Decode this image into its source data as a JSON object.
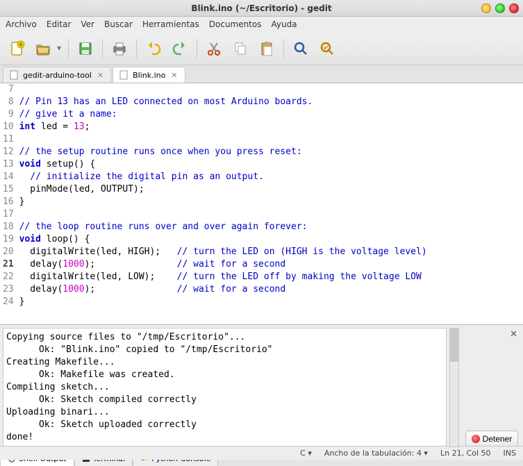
{
  "window": {
    "title": "Blink.ino (~/Escritorio) - gedit"
  },
  "menu": [
    "Archivo",
    "Editar",
    "Ver",
    "Buscar",
    "Herramientas",
    "Documentos",
    "Ayuda"
  ],
  "tabs": [
    {
      "label": "gedit-arduino-tool",
      "active": false
    },
    {
      "label": "Blink.ino",
      "active": true
    }
  ],
  "code_lines": [
    {
      "n": 7,
      "tokens": [
        {
          "t": " ",
          "c": ""
        }
      ]
    },
    {
      "n": 8,
      "tokens": [
        {
          "t": "// Pin 13 has an LED connected on most Arduino boards.",
          "c": "cm"
        }
      ]
    },
    {
      "n": 9,
      "tokens": [
        {
          "t": "// give it a name:",
          "c": "cm"
        }
      ]
    },
    {
      "n": 10,
      "tokens": [
        {
          "t": "int",
          "c": "kw"
        },
        {
          "t": " led = ",
          "c": ""
        },
        {
          "t": "13",
          "c": "num"
        },
        {
          "t": ";",
          "c": ""
        }
      ]
    },
    {
      "n": 11,
      "tokens": [
        {
          "t": " ",
          "c": ""
        }
      ]
    },
    {
      "n": 12,
      "tokens": [
        {
          "t": "// the setup routine runs once when you press reset:",
          "c": "cm"
        }
      ]
    },
    {
      "n": 13,
      "tokens": [
        {
          "t": "void",
          "c": "kw"
        },
        {
          "t": " setup() {",
          "c": ""
        }
      ]
    },
    {
      "n": 14,
      "tokens": [
        {
          "t": "  ",
          "c": ""
        },
        {
          "t": "// initialize the digital pin as an output.",
          "c": "cm"
        }
      ]
    },
    {
      "n": 15,
      "tokens": [
        {
          "t": "  pinMode(led, OUTPUT);",
          "c": ""
        }
      ]
    },
    {
      "n": 16,
      "tokens": [
        {
          "t": "}",
          "c": ""
        }
      ]
    },
    {
      "n": 17,
      "tokens": [
        {
          "t": " ",
          "c": ""
        }
      ]
    },
    {
      "n": 18,
      "tokens": [
        {
          "t": "// the loop routine runs over and over again forever:",
          "c": "cm"
        }
      ]
    },
    {
      "n": 19,
      "tokens": [
        {
          "t": "void",
          "c": "kw"
        },
        {
          "t": " loop() {",
          "c": ""
        }
      ]
    },
    {
      "n": 20,
      "tokens": [
        {
          "t": "  digitalWrite(led, HIGH);   ",
          "c": ""
        },
        {
          "t": "// turn the LED on (HIGH is the voltage level)",
          "c": "cm"
        }
      ]
    },
    {
      "n": 21,
      "tokens": [
        {
          "t": "  delay(",
          "c": ""
        },
        {
          "t": "1000",
          "c": "num"
        },
        {
          "t": ");               ",
          "c": ""
        },
        {
          "t": "// wait for a second",
          "c": "cm"
        }
      ]
    },
    {
      "n": 22,
      "tokens": [
        {
          "t": "  digitalWrite(led, LOW);    ",
          "c": ""
        },
        {
          "t": "// turn the LED off by making the voltage LOW",
          "c": "cm"
        }
      ]
    },
    {
      "n": 23,
      "tokens": [
        {
          "t": "  delay(",
          "c": ""
        },
        {
          "t": "1000",
          "c": "num"
        },
        {
          "t": ");               ",
          "c": ""
        },
        {
          "t": "// wait for a second",
          "c": "cm"
        }
      ]
    },
    {
      "n": 24,
      "tokens": [
        {
          "t": "}",
          "c": ""
        }
      ]
    }
  ],
  "current_line": 21,
  "output": "Copying source files to \"/tmp/Escritorio\"...\n      Ok: \"Blink.ino\" copied to \"/tmp/Escritorio\"\nCreating Makefile...\n      Ok: Makefile was created.\nCompiling sketch...\n      Ok: Sketch compiled correctly\nUploading binari...\n      Ok: Sketch uploaded correctly\ndone!",
  "detener_label": "Detener",
  "panel_tabs": [
    {
      "label": "Shell Output",
      "active": true
    },
    {
      "label": "Terminal",
      "active": false
    },
    {
      "label": "Python Console",
      "active": false
    }
  ],
  "status": {
    "lang": "C  ▾",
    "tabwidth": "Ancho de la tabulación:  4  ▾",
    "position": "Ln 21, Col 50",
    "ins": "INS"
  }
}
